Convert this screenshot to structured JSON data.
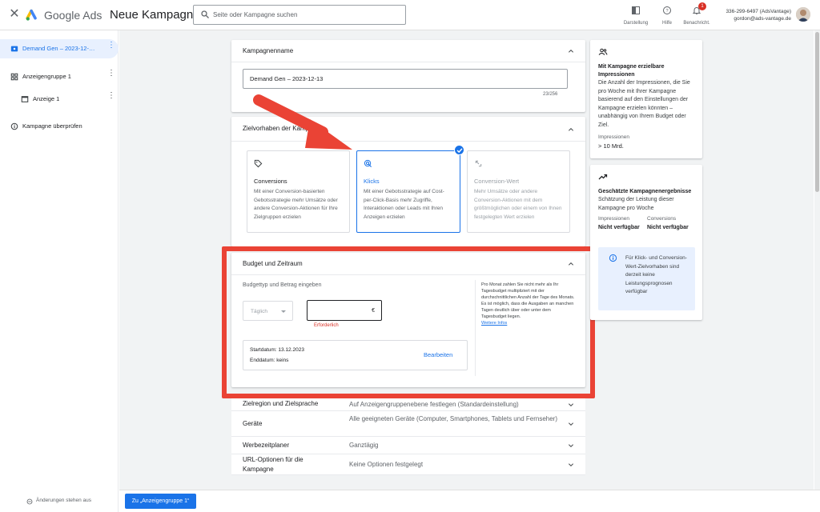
{
  "header": {
    "close_icon": "close-icon",
    "brand": "Google Ads",
    "title": "Neue Kampagne",
    "search_placeholder": "Seite oder Kampagne suchen",
    "buttons": [
      {
        "label": "Darstellung",
        "icon": "appearance-icon"
      },
      {
        "label": "Hilfe",
        "icon": "help-icon"
      },
      {
        "label": "Benachricht.",
        "icon": "bell-icon",
        "badge": "1"
      }
    ],
    "account_id": "336-299-6497 (AdsVantage)",
    "account_email": "gordon@ads-vantage.de"
  },
  "nav": {
    "items": [
      {
        "label": "Demand Gen – 2023-12-…"
      },
      {
        "label": "Anzeigengruppe 1"
      },
      {
        "label": "Anzeige 1"
      },
      {
        "label": "Kampagne überprüfen"
      }
    ],
    "changes": "Änderungen stehen aus"
  },
  "campaign_name": {
    "heading": "Kampagnenname",
    "value": "Demand Gen – 2023-12-13",
    "counter": "23/256"
  },
  "goals": {
    "heading": "Zielvorhaben der Kampagne",
    "options": [
      {
        "title": "Conversions",
        "desc": "Mit einer Conversion-basierten Gebotsstrategie mehr Umsätze oder andere Conversion-Aktionen für Ihre Zielgruppen erzielen"
      },
      {
        "title": "Klicks",
        "desc": "Mit einer Gebotsstrategie auf Cost-per-Click-Basis mehr Zugriffe, Interaktionen oder Leads mit Ihren Anzeigen erzielen"
      },
      {
        "title": "Conversion-Wert",
        "desc": "Mehr Umsätze oder andere Conversion-Aktionen mit dem größtmöglichen oder einem von Ihnen festgelegten Wert erzielen"
      }
    ]
  },
  "budget": {
    "heading": "Budget und Zeitraum",
    "subheading": "Budgettyp und Betrag eingeben",
    "type_value": "Täglich",
    "currency": "€",
    "required": "Erforderlich",
    "help_text": "Pro Monat zahlen Sie nicht mehr als Ihr Tagesbudget multipliziert mit der durchschnittlichen Anzahl der Tage des Monats. Es ist möglich, dass die Ausgaben an manchen Tagen deutlich über oder unter dem Tagesbudget liegen.",
    "help_link": "Weitere Infos",
    "start_date": "Startdatum: 13.12.2023",
    "end_date": "Enddatum: keins",
    "edit": "Bearbeiten"
  },
  "rows": [
    {
      "label": "Zielregion und Zielsprache",
      "value": "Auf Anzeigengruppenebene festlegen (Standardeinstellung)"
    },
    {
      "label": "Geräte",
      "value": "Alle geeigneten Geräte (Computer, Smartphones, Tablets und Fernseher)"
    },
    {
      "label": "Werbezeitplaner",
      "value": "Ganztägig"
    },
    {
      "label": "URL-Optionen für die Kampagne",
      "value": "Keine Optionen festgelegt"
    }
  ],
  "right": {
    "impressions_title": "Mit Kampagne erzielbare Impressionen",
    "impressions_text": "Die Anzahl der Impressionen, die Sie pro Woche mit Ihrer Kampagne basierend auf den Einstellungen der Kampagne erzielen könnten – unabhängig von Ihrem Budget oder Ziel.",
    "impressions_label": "Impressionen",
    "impressions_value": "> 10 Mrd.",
    "results_title": "Geschätzte Kampagnenergebnisse",
    "results_text": "Schätzung der Leistung dieser Kampagne pro Woche",
    "col1_label": "Impressionen",
    "col1_value": "Nicht verfügbar",
    "col2_label": "Conversions",
    "col2_value": "Nicht verfügbar",
    "info": "Für Klick- und Conversion-Wert-Zielvorhaben sind derzeit keine Leistungsprognosen verfügbar"
  },
  "footer": {
    "next_button": "Zu „Anzeigengruppe 1“"
  },
  "colors": {
    "accent": "#1a73e8",
    "highlight": "#ea4335",
    "error": "#d93025"
  }
}
